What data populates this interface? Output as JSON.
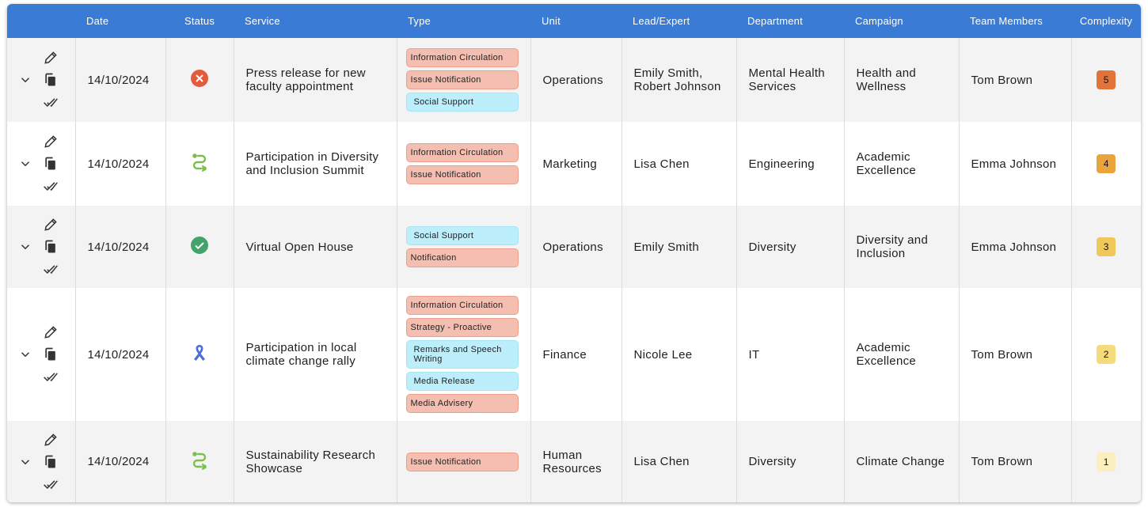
{
  "header": {
    "date": "Date",
    "status": "Status",
    "service": "Service",
    "type": "Type",
    "unit": "Unit",
    "lead": "Lead/Expert",
    "department": "Department",
    "campaign": "Campaign",
    "team": "Team Members",
    "complexity": "Complexity"
  },
  "colors": {
    "header_bg": "#3a7bd5",
    "tag_red": "#f4bfb0",
    "tag_blue": "#bdeefb",
    "complexity_5": "#e2733a",
    "complexity_4": "#eba33d",
    "complexity_3": "#f0c75a",
    "complexity_2": "#f5dc7a",
    "complexity_1": "#fbefc0"
  },
  "rows": [
    {
      "date": "14/10/2024",
      "status_icon": "cancel-icon",
      "service": "Press release for new faculty appointment",
      "types": [
        {
          "label": "Information Circulation",
          "color": "red"
        },
        {
          "label": "Issue Notification",
          "color": "red"
        },
        {
          "label": "Social Support",
          "color": "blue"
        }
      ],
      "unit": "Operations",
      "lead": "Emily Smith, Robert Johnson",
      "department": "Mental Health Services",
      "campaign": "Health and Wellness",
      "team": "Tom Brown",
      "complexity": "5"
    },
    {
      "date": "14/10/2024",
      "status_icon": "route-icon",
      "service": "Participation in Diversity and Inclusion Summit",
      "types": [
        {
          "label": "Information Circulation",
          "color": "red"
        },
        {
          "label": "Issue Notification",
          "color": "red"
        }
      ],
      "unit": "Marketing",
      "lead": "Lisa Chen",
      "department": "Engineering",
      "campaign": "Academic Excellence",
      "team": "Emma Johnson",
      "complexity": "4"
    },
    {
      "date": "14/10/2024",
      "status_icon": "check-circle-icon",
      "service": "Virtual Open House",
      "types": [
        {
          "label": "Social Support",
          "color": "blue"
        },
        {
          "label": "Notification",
          "color": "red"
        }
      ],
      "unit": "Operations",
      "lead": "Emily Smith",
      "department": "Diversity",
      "campaign": "Diversity and Inclusion",
      "team": "Emma Johnson",
      "complexity": "3"
    },
    {
      "date": "14/10/2024",
      "status_icon": "ribbon-icon",
      "service": "Participation in local climate change rally",
      "types": [
        {
          "label": "Information Circulation",
          "color": "red"
        },
        {
          "label": "Strategy - Proactive",
          "color": "red"
        },
        {
          "label": "Remarks and Speech Writing",
          "color": "blue"
        },
        {
          "label": "Media Release",
          "color": "blue"
        },
        {
          "label": "Media Advisery",
          "color": "red"
        }
      ],
      "unit": "Finance",
      "lead": "Nicole Lee",
      "department": "IT",
      "campaign": "Academic Excellence",
      "team": "Tom Brown",
      "complexity": "2"
    },
    {
      "date": "14/10/2024",
      "status_icon": "route-icon",
      "service": "Sustainability Research Showcase",
      "types": [
        {
          "label": "Issue Notification",
          "color": "red"
        }
      ],
      "unit": "Human Resources",
      "lead": "Lisa Chen",
      "department": "Diversity",
      "campaign": "Climate Change",
      "team": "Tom Brown",
      "complexity": "1"
    }
  ]
}
